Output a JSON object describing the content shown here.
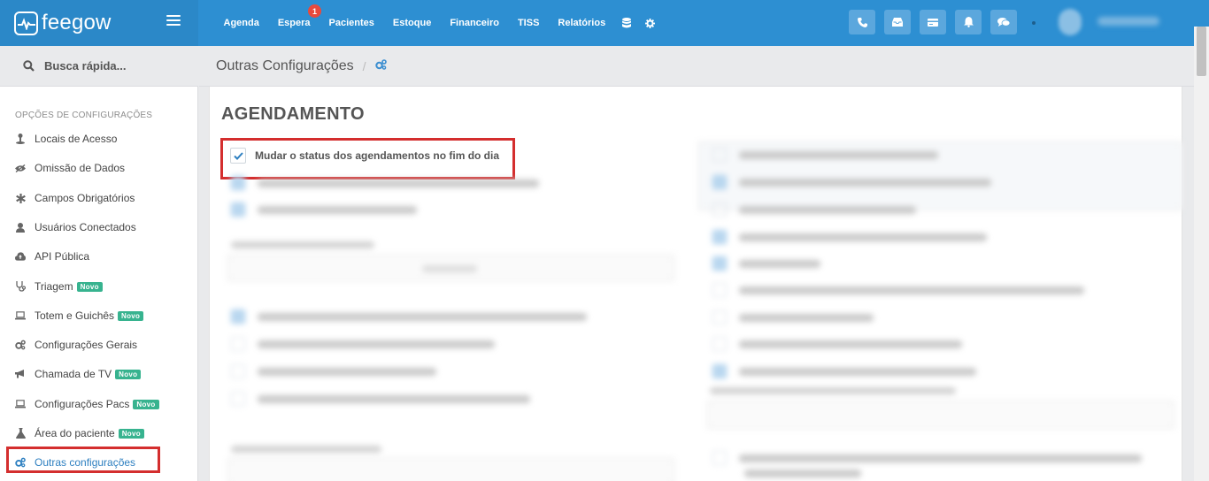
{
  "brand": {
    "name": "feegow"
  },
  "nav": {
    "items": [
      {
        "label": "Agenda"
      },
      {
        "label": "Espera",
        "badge": "1"
      },
      {
        "label": "Pacientes"
      },
      {
        "label": "Estoque"
      },
      {
        "label": "Financeiro"
      },
      {
        "label": "TISS"
      },
      {
        "label": "Relatórios"
      }
    ],
    "icons": [
      "database-icon",
      "gear-icon"
    ],
    "tools": [
      "phone-icon",
      "inbox-icon",
      "card-icon",
      "bell-icon",
      "chat-icon"
    ]
  },
  "search": {
    "placeholder": "Busca rápida..."
  },
  "sidebar": {
    "heading": "OPÇÕES DE CONFIGURAÇÕES",
    "new_badge": "Novo",
    "items": [
      {
        "label": "Locais de Acesso",
        "icon": "map-pin-icon"
      },
      {
        "label": "Omissão de Dados",
        "icon": "eye-slash-icon"
      },
      {
        "label": "Campos Obrigatórios",
        "icon": "asterisk-icon"
      },
      {
        "label": "Usuários Conectados",
        "icon": "user-icon"
      },
      {
        "label": "API Pública",
        "icon": "cloud-upload-icon"
      },
      {
        "label": "Triagem",
        "icon": "stethoscope-icon",
        "new": true
      },
      {
        "label": "Totem e Guichês",
        "icon": "laptop-icon",
        "new": true
      },
      {
        "label": "Configurações Gerais",
        "icon": "cogs-icon"
      },
      {
        "label": "Chamada de TV",
        "icon": "bullhorn-icon",
        "new": true
      },
      {
        "label": "Configurações Pacs",
        "icon": "laptop-icon",
        "new": true
      },
      {
        "label": "Área do paciente",
        "icon": "flask-icon",
        "new": true
      },
      {
        "label": "Outras configurações",
        "icon": "cogs-icon",
        "active": true
      }
    ]
  },
  "breadcrumb": {
    "title": "Outras Configurações",
    "separator": "/",
    "icon": "cogs-icon"
  },
  "main": {
    "section_title": "AGENDAMENTO",
    "highlighted_option": {
      "label": "Mudar o status dos agendamentos no fim do dia",
      "checked": true
    }
  },
  "colors": {
    "navbar": "#2d8fd2",
    "highlight": "#d42e2e",
    "new_badge": "#37b38f",
    "notification_badge": "#e84a3d"
  }
}
